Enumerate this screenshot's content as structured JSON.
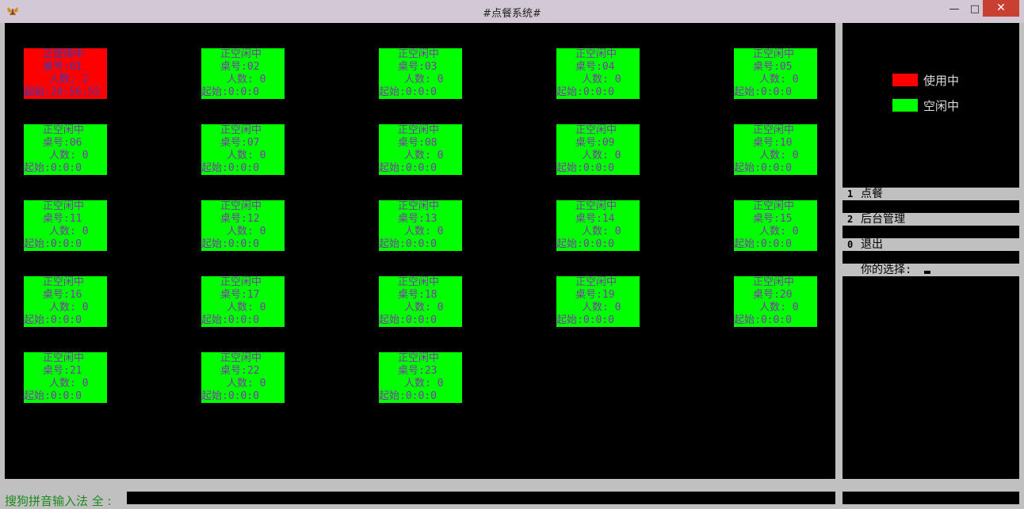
{
  "window": {
    "title": "#点餐系统#",
    "minimize_glyph": "—",
    "maximize_glyph": "□",
    "close_glyph": "✕"
  },
  "colors": {
    "busy": "#ff0000",
    "free": "#00ff00",
    "background": "#000000"
  },
  "tables": [
    {
      "status": "正使用中",
      "table_no": "桌号:01",
      "people": "人数: 2",
      "start": "起始:20:56:55",
      "busy": true
    },
    {
      "status": "正空闲中",
      "table_no": "桌号:02",
      "people": "人数: 0",
      "start": "起始:0:0:0",
      "busy": false
    },
    {
      "status": "正空闲中",
      "table_no": "桌号:03",
      "people": "人数: 0",
      "start": "起始:0:0:0",
      "busy": false
    },
    {
      "status": "正空闲中",
      "table_no": "桌号:04",
      "people": "人数: 0",
      "start": "起始:0:0:0",
      "busy": false
    },
    {
      "status": "正空闲中",
      "table_no": "桌号:05",
      "people": "人数: 0",
      "start": "起始:0:0:0",
      "busy": false
    },
    {
      "status": "正空闲中",
      "table_no": "桌号:06",
      "people": "人数: 0",
      "start": "起始:0:0:0",
      "busy": false
    },
    {
      "status": "正空闲中",
      "table_no": "桌号:07",
      "people": "人数: 0",
      "start": "起始:0:0:0",
      "busy": false
    },
    {
      "status": "正空闲中",
      "table_no": "桌号:08",
      "people": "人数: 0",
      "start": "起始:0:0:0",
      "busy": false
    },
    {
      "status": "正空闲中",
      "table_no": "桌号:09",
      "people": "人数: 0",
      "start": "起始:0:0:0",
      "busy": false
    },
    {
      "status": "正空闲中",
      "table_no": "桌号:10",
      "people": "人数: 0",
      "start": "起始:0:0:0",
      "busy": false
    },
    {
      "status": "正空闲中",
      "table_no": "桌号:11",
      "people": "人数: 0",
      "start": "起始:0:0:0",
      "busy": false
    },
    {
      "status": "正空闲中",
      "table_no": "桌号:12",
      "people": "人数: 0",
      "start": "起始:0:0:0",
      "busy": false
    },
    {
      "status": "正空闲中",
      "table_no": "桌号:13",
      "people": "人数: 0",
      "start": "起始:0:0:0",
      "busy": false
    },
    {
      "status": "正空闲中",
      "table_no": "桌号:14",
      "people": "人数: 0",
      "start": "起始:0:0:0",
      "busy": false
    },
    {
      "status": "正空闲中",
      "table_no": "桌号:15",
      "people": "人数: 0",
      "start": "起始:0:0:0",
      "busy": false
    },
    {
      "status": "正空闲中",
      "table_no": "桌号:16",
      "people": "人数: 0",
      "start": "起始:0:0:0",
      "busy": false
    },
    {
      "status": "正空闲中",
      "table_no": "桌号:17",
      "people": "人数: 0",
      "start": "起始:0:0:0",
      "busy": false
    },
    {
      "status": "正空闲中",
      "table_no": "桌号:18",
      "people": "人数: 0",
      "start": "起始:0:0:0",
      "busy": false
    },
    {
      "status": "正空闲中",
      "table_no": "桌号:19",
      "people": "人数: 0",
      "start": "起始:0:0:0",
      "busy": false
    },
    {
      "status": "正空闲中",
      "table_no": "桌号:20",
      "people": "人数: 0",
      "start": "起始:0:0:0",
      "busy": false
    },
    {
      "status": "正空闲中",
      "table_no": "桌号:21",
      "people": "人数: 0",
      "start": "起始:0:0:0",
      "busy": false
    },
    {
      "status": "正空闲中",
      "table_no": "桌号:22",
      "people": "人数: 0",
      "start": "起始:0:0:0",
      "busy": false
    },
    {
      "status": "正空闲中",
      "table_no": "桌号:23",
      "people": "人数: 0",
      "start": "起始:0:0:0",
      "busy": false
    }
  ],
  "legend": {
    "busy_label": "使用中",
    "free_label": "空闲中"
  },
  "menu": {
    "items": [
      {
        "key": "1",
        "label": "点餐"
      },
      {
        "key": "2",
        "label": "后台管理"
      },
      {
        "key": "0",
        "label": "退出"
      }
    ],
    "prompt": "你的选择:"
  },
  "ime": {
    "label": "搜狗拼音输入法 全 :"
  }
}
